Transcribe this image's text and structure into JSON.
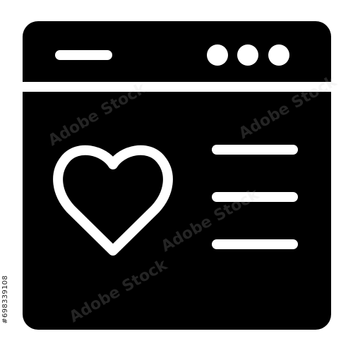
{
  "icon": {
    "name": "browser-window-favorite-icon",
    "colors": {
      "fill": "#000000",
      "detail": "#ffffff",
      "background": "#ffffff"
    }
  },
  "watermark": {
    "text": "Adobe Stock"
  },
  "stock_id": "#698339108"
}
